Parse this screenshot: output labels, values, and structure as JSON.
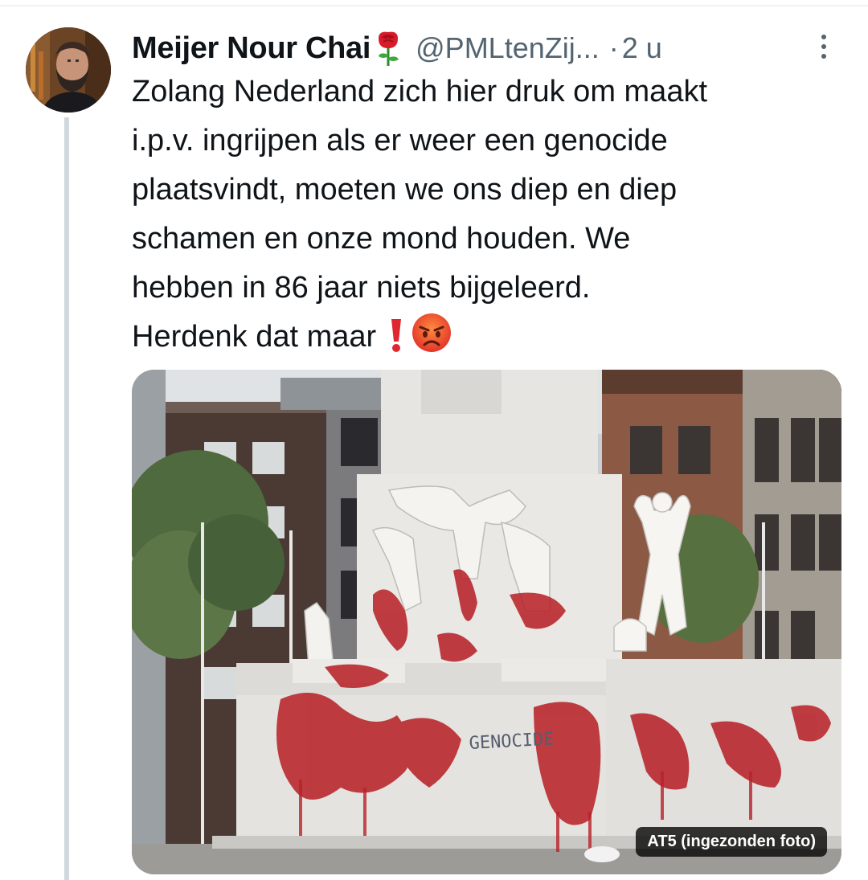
{
  "tweet": {
    "author": {
      "display_name": "Meijer Nour Chai",
      "handle": "@PMLtenZij...",
      "avatar_icon": "profile-photo-bearded-man",
      "name_emoji": "rose-icon"
    },
    "separator": "·",
    "time": "2 u",
    "more_icon": "kebab-menu-icon",
    "text_lines": [
      "Zolang Nederland zich hier druk om maakt",
      "i.p.v. ingrijpen als er weer een genocide",
      "plaatsvindt, moeten we ons diep en diep",
      "schamen en onze mond houden. We",
      "hebben in 86 jaar niets bijgeleerd.",
      "Herdenk dat maar"
    ],
    "trailing_emoji": [
      "exclamation-icon",
      "angry-face-icon"
    ],
    "media": {
      "description_icon": "monument-photo",
      "badge": "AT5 (ingezonden foto)",
      "graffiti_text": "GENOCIDE"
    }
  },
  "colors": {
    "text_primary": "#0f1419",
    "text_secondary": "#536471",
    "thread_line": "#cfd9de",
    "paint_red": "#b8232a"
  }
}
